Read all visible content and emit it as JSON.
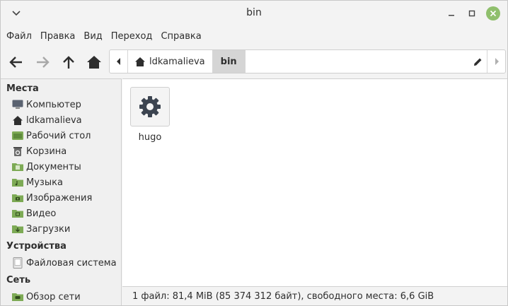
{
  "window": {
    "title": "bin"
  },
  "menubar": {
    "items": [
      "Файл",
      "Правка",
      "Вид",
      "Переход",
      "Справка"
    ]
  },
  "toolbar": {
    "back_icon": "arrow-left-icon",
    "forward_icon": "arrow-right-icon",
    "up_icon": "arrow-up-icon",
    "home_icon": "home-icon"
  },
  "pathbar": {
    "crumbs": [
      "ldkamalieva",
      "bin"
    ]
  },
  "sidebar": {
    "places_title": "Места",
    "places": [
      {
        "label": "Компьютер",
        "icon": "computer-icon"
      },
      {
        "label": "ldkamalieva",
        "icon": "home-icon"
      },
      {
        "label": "Рабочий стол",
        "icon": "desktop-folder-icon"
      },
      {
        "label": "Корзина",
        "icon": "trash-icon"
      },
      {
        "label": "Документы",
        "icon": "documents-folder-icon"
      },
      {
        "label": "Музыка",
        "icon": "music-folder-icon"
      },
      {
        "label": "Изображения",
        "icon": "pictures-folder-icon"
      },
      {
        "label": "Видео",
        "icon": "videos-folder-icon"
      },
      {
        "label": "Загрузки",
        "icon": "downloads-folder-icon"
      }
    ],
    "devices_title": "Устройства",
    "devices": [
      {
        "label": "Файловая система",
        "icon": "drive-icon"
      }
    ],
    "network_title": "Сеть",
    "network": [
      {
        "label": "Обзор сети",
        "icon": "network-folder-icon"
      }
    ]
  },
  "files": [
    {
      "name": "hugo",
      "icon": "executable-gear-icon"
    }
  ],
  "statusbar": {
    "text": "1 файл: 81,4 MiB (85 374 312 байт), свободного места: 6,6 GiB"
  },
  "colors": {
    "accent_green": "#8fbf6c",
    "folder_green": "#7daa55",
    "icon_dark": "#3c4450"
  }
}
